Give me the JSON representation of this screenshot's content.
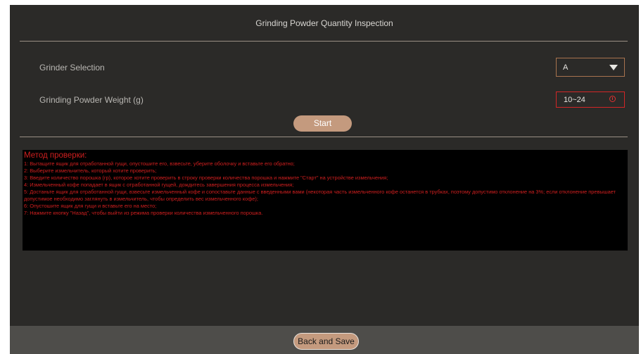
{
  "header": {
    "title": "Grinding Powder Quantity Inspection"
  },
  "grinder_selection": {
    "label": "Grinder Selection",
    "value": "A"
  },
  "grinding_weight": {
    "label": "Grinding Powder Weight (g)",
    "value": "10~24"
  },
  "start_button": {
    "label": "Start"
  },
  "method": {
    "title": "Метод проверки:",
    "lines": [
      "1: Вытащите ящик для отработанной гущи, опустошите его, взвесьте, уберите оболочку и вставьте его обратно;",
      "2: Выберите измельчитель, который хотите проверить;",
      "3: Введите количество порошка (гр), которое хотите проверить в строку проверки количества порошка и нажмите \"Старт\" на устройстве измельчения;",
      "4: Измельченный кофе попадает в ящик с отработанной гущей, дождитесь завершения процесса измельчения;",
      "5: Достаньте ящик для отработанной гущи, взвесьте измельченный кофе и сопоставьте данные с введенными вами (некоторая часть измельченного кофе останется в трубках, поэтому допустимо отклонение на 3%; если отклонение превышает допустимое необходимо заглянуть в измельчитель, чтобы определить вес измельченного кофе);",
      "6: Опустошите ящик для гущи и вставьте его на место;",
      "7: Нажмите кнопку \"Назад\", чтобы выйти из режима проверки количества измельченного порошка."
    ]
  },
  "footer": {
    "back_label": "Back and Save"
  },
  "colors": {
    "panel": "#2b2a28",
    "accent": "#c49a7e",
    "error": "#d22626",
    "method_text": "#d01f1f"
  }
}
